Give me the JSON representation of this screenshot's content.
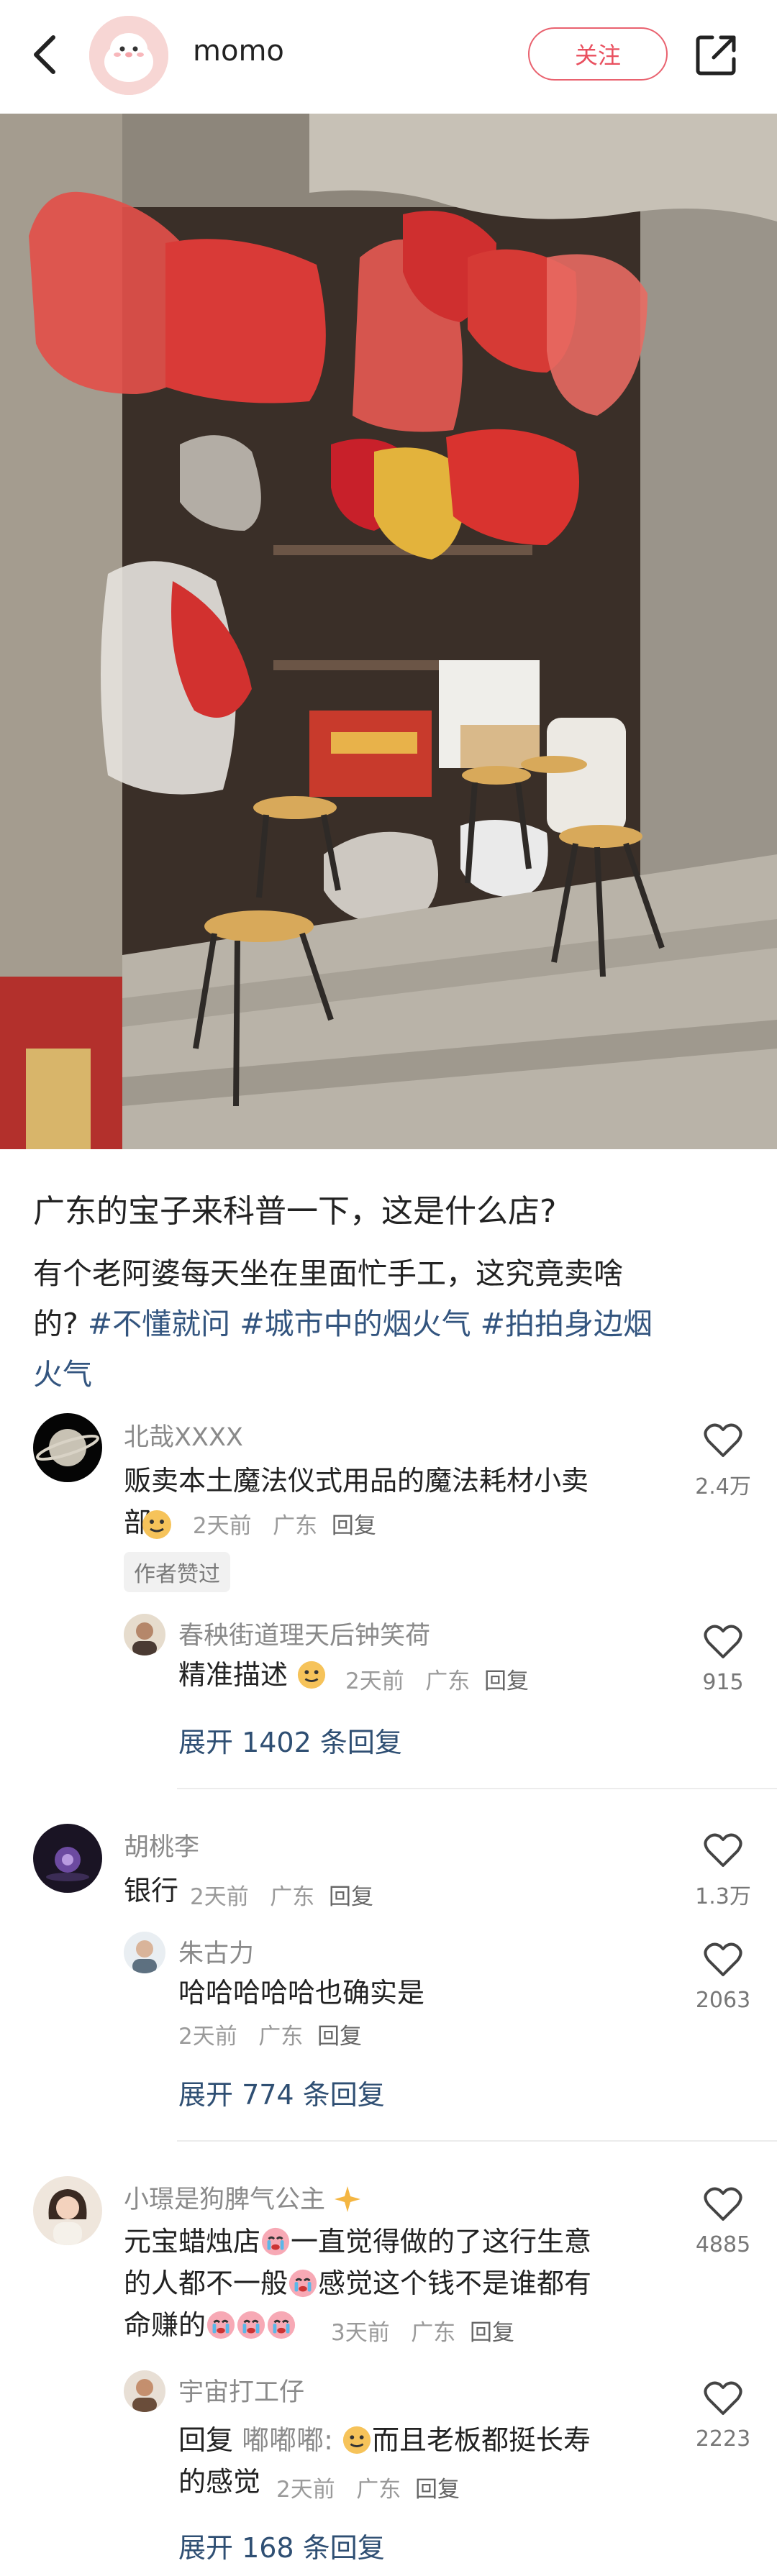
{
  "header": {
    "username": "momo",
    "follow_label": "关注"
  },
  "post": {
    "title": "广东的宝子来科普一下，这是什么店?",
    "body_line1": "有个老阿婆每天坐在里面忙手工，这究竟卖啥",
    "body_line2_prefix": "的?",
    "tags": [
      "#不懂就问",
      "#城市中的烟火气",
      "#拍拍身边烟",
      "火气"
    ]
  },
  "comments": [
    {
      "name": "北哉XXXX",
      "text_line1": "贩卖本土魔法仪式用品的魔法耗材小卖",
      "text_line2": "部。",
      "time": "2天前",
      "location": "广东",
      "reply": "回复",
      "likes": "2.4万",
      "badge": "作者赞过",
      "replies": [
        {
          "name": "春秧街道理天后钟笑荷",
          "text": "精准描述",
          "time": "2天前",
          "location": "广东",
          "reply": "回复",
          "likes": "915"
        }
      ],
      "expand_label": "展开 1402 条回复"
    },
    {
      "name": "胡桃李",
      "text": "银行",
      "time": "2天前",
      "location": "广东",
      "reply": "回复",
      "likes": "1.3万",
      "replies": [
        {
          "name": "朱古力",
          "text": "哈哈哈哈哈也确实是",
          "time": "2天前",
          "location": "广东",
          "reply": "回复",
          "likes": "2063"
        }
      ],
      "expand_label": "展开 774 条回复"
    },
    {
      "name": "小璟是狗脾气公主",
      "text_line1": "元宝蜡烛店",
      "text_line1b": "一直觉得做的了这行生意",
      "text_line2a": "的人都不一般",
      "text_line2b": "感觉这个钱不是谁都有",
      "text_line3": "命赚的",
      "time": "3天前",
      "location": "广东",
      "reply": "回复",
      "likes": "4885",
      "replies": [
        {
          "name": "宇宙打工仔",
          "text_prefix": "回复",
          "mention": "嘟嘟嘟:",
          "text_line1": "而且老板都挺长寿",
          "text_line2": "的感觉",
          "time": "2天前",
          "location": "广东",
          "reply": "回复",
          "likes": "2223"
        }
      ],
      "expand_label": "展开 168 条回复"
    }
  ]
}
